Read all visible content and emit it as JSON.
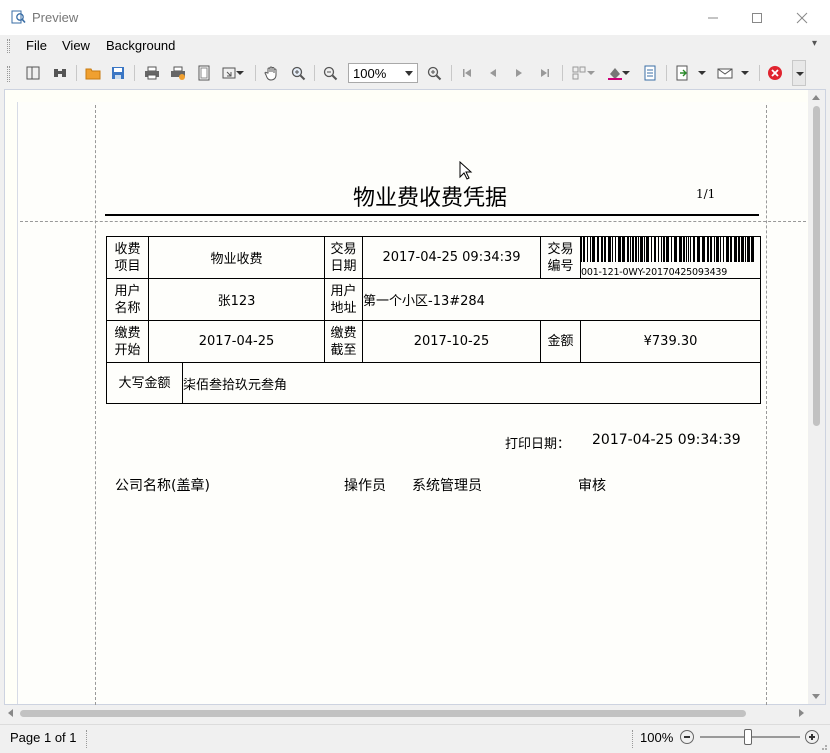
{
  "window": {
    "title": "Preview",
    "minimize": "—",
    "maximize": "☐",
    "close": "✕"
  },
  "menu": {
    "items": [
      "File",
      "View",
      "Background"
    ],
    "more": "▾"
  },
  "toolbar": {
    "zoom_value": "100%",
    "icons": [
      "layout-icon",
      "find-icon",
      "open-icon",
      "save-icon",
      "print-icon",
      "quick-print-icon",
      "page-setup-icon",
      "scale-icon",
      "hand-tool-icon",
      "magnifier-icon",
      "zoom-out-icon",
      "zoom-in-icon",
      "first-page-icon",
      "previous-page-icon",
      "next-page-icon",
      "last-page-icon",
      "multipage-icon",
      "background-color-icon",
      "watermark-icon",
      "export-icon",
      "send-email-icon",
      "close-preview-icon"
    ]
  },
  "receipt": {
    "title": "物业费收费凭据",
    "page_number": "1/1",
    "rows": {
      "item_label": "收费\n项目",
      "item_value": "物业收费",
      "trade_date_label": "交易\n日期",
      "trade_date_value": "2017-04-25 09:34:39",
      "trade_no_label": "交易\n编号",
      "trade_no_value": "001-121-0WY-20170425093439",
      "user_name_label": "用户\n名称",
      "user_name_value": "张123",
      "user_address_label": "用户\n地址",
      "user_address_value": "第一个小区-13#284",
      "pay_start_label": "缴费\n开始",
      "pay_start_value": "2017-04-25",
      "pay_end_label": "缴费\n截至",
      "pay_end_value": "2017-10-25",
      "amount_label": "金额",
      "amount_value": "¥739.30",
      "amount_words_label": "大写金额",
      "amount_words_value": "柒佰叁拾玖元叁角"
    },
    "print_date_label": "打印日期：",
    "print_date_value": "2017-04-25 09:34:39",
    "company_label": "公司名称(盖章)",
    "operator_label": "操作员",
    "operator_value": "系统管理员",
    "review_label": "审核"
  },
  "status": {
    "page_info": "Page 1 of 1",
    "zoom": "100%"
  }
}
